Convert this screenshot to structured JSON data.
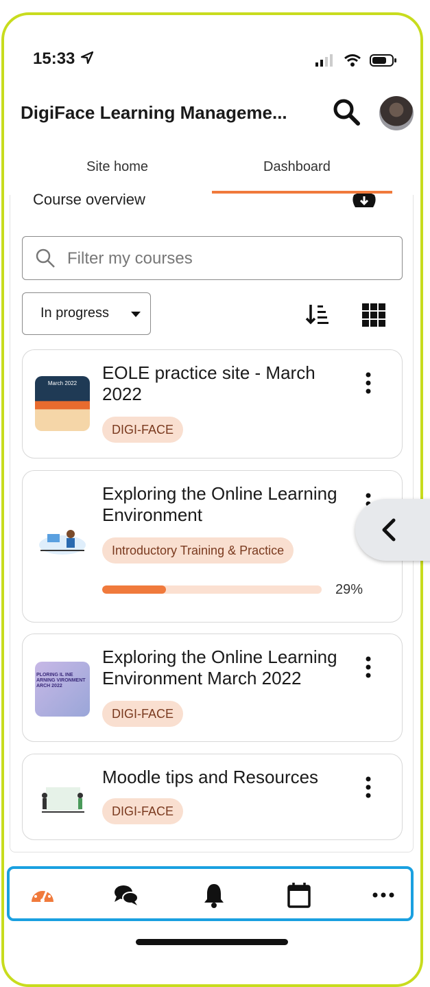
{
  "status_bar": {
    "time": "15:33",
    "location_icon": "location-arrow-icon",
    "signal_icon": "signal-icon",
    "wifi_icon": "wifi-icon",
    "battery_icon": "battery-icon"
  },
  "header": {
    "title": "DigiFace Learning Manageme...",
    "search_icon": "search-icon",
    "avatar": "user-avatar"
  },
  "tabs": [
    {
      "label": "Site home",
      "active": false
    },
    {
      "label": "Dashboard",
      "active": true
    }
  ],
  "section": {
    "title": "Course overview",
    "download_icon": "download-icon"
  },
  "filter": {
    "placeholder": "Filter my courses"
  },
  "controls": {
    "select_value": "In progress",
    "sort_icon": "sort-icon",
    "grid_icon": "grid-view-icon"
  },
  "courses": [
    {
      "title": "EOLE practice site - March 2022",
      "category": "DIGI-FACE",
      "thumb_label": "March 2022"
    },
    {
      "title": "Exploring the Online Learning Environment",
      "category": "Introductory Training & Practice",
      "progress": 29,
      "progress_label": "29%"
    },
    {
      "title": "Exploring the Online Learning Environment March 2022",
      "category": "DIGI-FACE",
      "thumb_label": "PLORING IL INE ARNING VIRONMENT ARCH 2022"
    },
    {
      "title": "Moodle tips and Resources",
      "category": "DIGI-FACE"
    }
  ],
  "bottom_nav": [
    "dashboard-icon",
    "messages-icon",
    "notifications-icon",
    "calendar-icon",
    "more-icon"
  ],
  "colors": {
    "accent": "#f07a3c",
    "badge_bg": "#f9dfd0",
    "frame": "#c8dc1e",
    "nav_border": "#1aa0e0"
  }
}
